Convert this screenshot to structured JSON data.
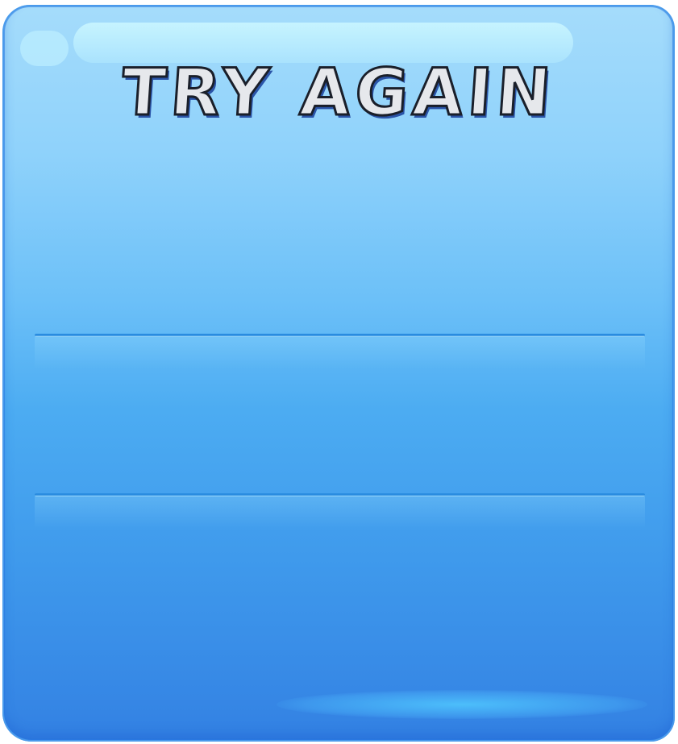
{
  "dialog": {
    "title": "TRY AGAIN"
  },
  "colors": {
    "panel_top": "#a5dcfb",
    "panel_bottom": "#3381e3",
    "title_fill": "#e6e8ec",
    "title_outline": "#1a1f2a",
    "divider": "#2a8ce0"
  }
}
